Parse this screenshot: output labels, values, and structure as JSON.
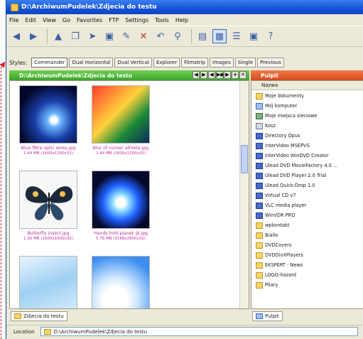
{
  "window": {
    "title": "D:\\ArchiwumPudelek\\Zdjecia do testu"
  },
  "menu": [
    "File",
    "Edit",
    "View",
    "Go",
    "Favorites",
    "FTP",
    "Settings",
    "Tools",
    "Help"
  ],
  "toolbar": {
    "icons": [
      "back-icon",
      "forward-icon",
      "up-icon",
      "copy-icon",
      "move-icon",
      "new-folder-icon",
      "rename-icon",
      "delete-icon",
      "undo-icon",
      "find-icon",
      "view-mode-icon",
      "thumbnails-icon",
      "details-icon",
      "properties-icon",
      "help-icon"
    ]
  },
  "styles": {
    "label": "Styles:",
    "tabs": [
      "Commander",
      "Dual Horizontal",
      "Dual Vertical",
      "Explorer",
      "Filmstrip",
      "Images",
      "Single",
      "Previous"
    ],
    "selected": "Commander"
  },
  "left_pane": {
    "path": "D:\\ArchiwumPudelek\\Zdjecia do testu",
    "nav_buttons": [
      "◀",
      "▶",
      "◀",
      "▶▶",
      "▶",
      "+",
      "✕"
    ],
    "thumbnails": [
      {
        "name": "Blue fibre optic wires.jpg",
        "meta": "1.44 MB (1600x1200x32)"
      },
      {
        "name": "Blur of runner athlete.jpg",
        "meta": "1.44 MB (1600x1200x32)"
      },
      {
        "name": "Butterfly insect.jpg",
        "meta": "1.26 MB (1600x1600x32)"
      },
      {
        "name": "Hands hold planet @.jpg",
        "meta": "5.76 MB (3168x2800x32)"
      },
      {
        "name": "",
        "meta": ""
      },
      {
        "name": "",
        "meta": ""
      }
    ],
    "footer_tab": "Zdjecia do testu"
  },
  "right_pane": {
    "title": "Pulpit",
    "column_header": "Nazwa",
    "items": [
      {
        "label": "Moje dokumenty",
        "icon": "folder-icon"
      },
      {
        "label": "Mój komputer",
        "icon": "computer-icon"
      },
      {
        "label": "Moje miejsca sieciowe",
        "icon": "network-icon"
      },
      {
        "label": "Kosz",
        "icon": "recycle-bin-icon"
      },
      {
        "label": "Directory Opus",
        "icon": "app-icon"
      },
      {
        "label": "InterVideo MSEPVS",
        "icon": "app-icon"
      },
      {
        "label": "InterVideo WinDVD Creator",
        "icon": "app-icon"
      },
      {
        "label": "Ulead DVD MovieFactory 4.0 ...",
        "icon": "app-icon"
      },
      {
        "label": "Ulead DVD Player 2.0 Trial",
        "icon": "app-icon"
      },
      {
        "label": "Ulead Quick-Drop 1.0",
        "icon": "app-icon"
      },
      {
        "label": "Virtual CD v7",
        "icon": "app-icon"
      },
      {
        "label": "VLC media player",
        "icon": "app-icon"
      },
      {
        "label": "WinVDR PRO",
        "icon": "app-icon"
      },
      {
        "label": "wpkontakt",
        "icon": "folder-icon"
      },
      {
        "label": "Bialla",
        "icon": "folder-icon"
      },
      {
        "label": "DVDCovers",
        "icon": "folder-icon"
      },
      {
        "label": "DVDDivXPlayers",
        "icon": "folder-icon"
      },
      {
        "label": "EKSPERT - News",
        "icon": "folder-icon"
      },
      {
        "label": "LOGO-hazard",
        "icon": "folder-icon"
      },
      {
        "label": "Pliary",
        "icon": "folder-icon"
      }
    ],
    "footer_tab": "Pulpit"
  },
  "location": {
    "label": "Location",
    "value": "D:\\ArchiwumPudelek\\Zdjecia do testu"
  },
  "accent": {
    "left_header": "#3aa42a",
    "right_header": "#d64a1f",
    "caption": "#c02aa0"
  }
}
